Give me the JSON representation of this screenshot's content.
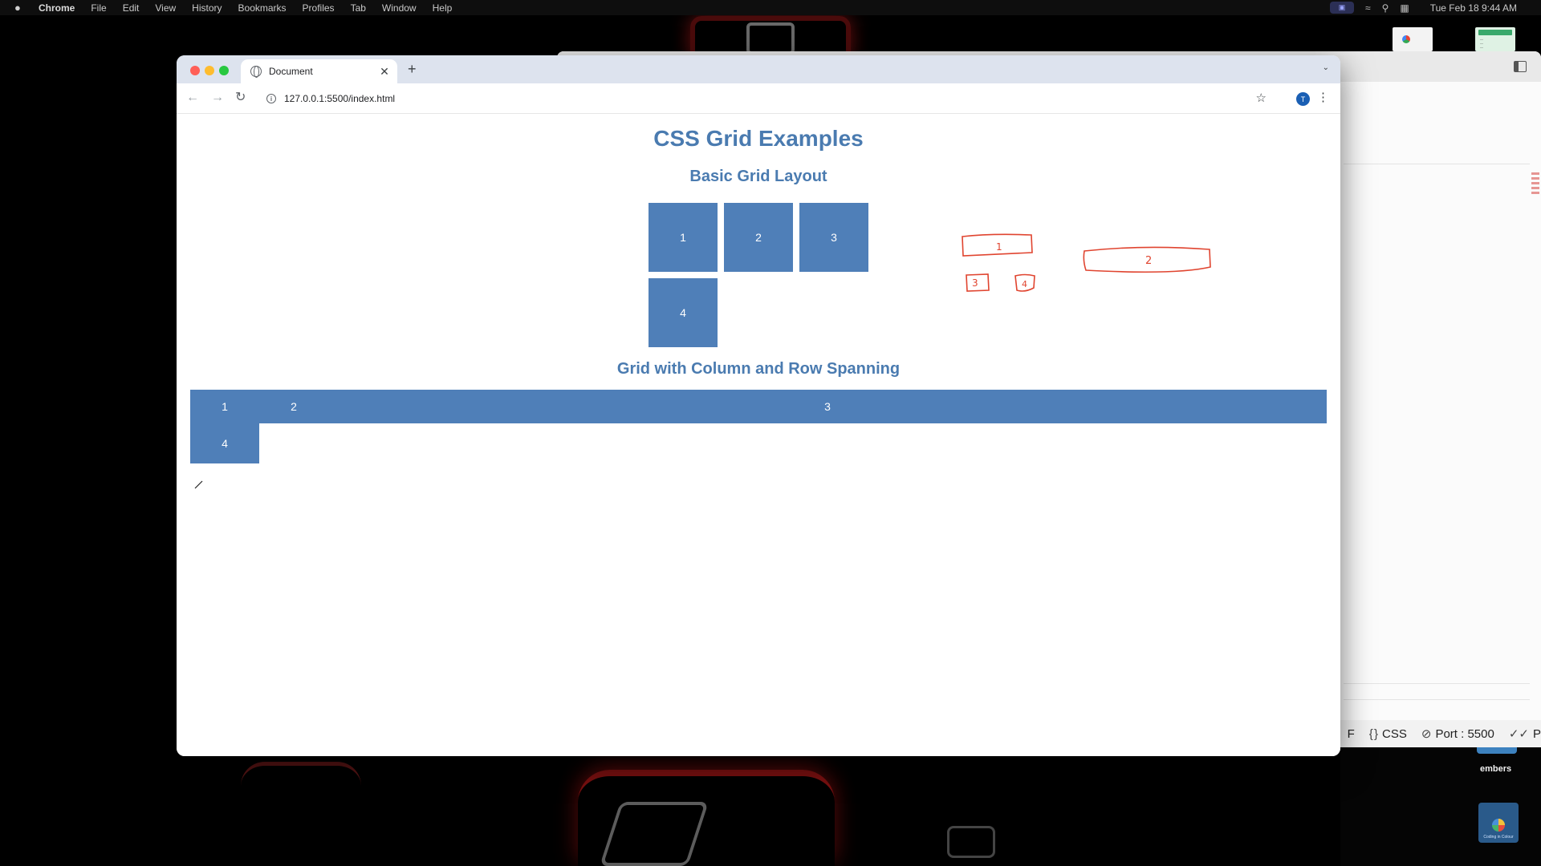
{
  "menubar": {
    "app": "Chrome",
    "items": [
      "File",
      "Edit",
      "View",
      "History",
      "Bookmarks",
      "Profiles",
      "Tab",
      "Window",
      "Help"
    ],
    "clock": "Tue Feb 18  9:44 AM"
  },
  "browser": {
    "tab_title": "Document",
    "tab_close": "✕",
    "new_tab": "+",
    "url": "127.0.0.1:5500/index.html",
    "profile_initial": "T"
  },
  "page": {
    "title": "CSS Grid Examples",
    "basic_heading": "Basic Grid Layout",
    "basic_items": [
      "1",
      "2",
      "3",
      "4"
    ],
    "span_heading": "Grid with Column and Row Spanning",
    "span_items": [
      "1",
      "2",
      "3",
      "4"
    ]
  },
  "sketch": {
    "labels": [
      "1",
      "2",
      "3",
      "4"
    ],
    "stroke_color": "#e0442f"
  },
  "editor_status": {
    "left_cut": "F",
    "language": "CSS",
    "port": "Port : 5500",
    "right_cut": "P"
  },
  "dock": {
    "label": "embers",
    "logo_text": "Coding in Colour"
  },
  "colors": {
    "accent_blue": "#4f7fb8",
    "heading_blue": "#4a7bb0"
  }
}
